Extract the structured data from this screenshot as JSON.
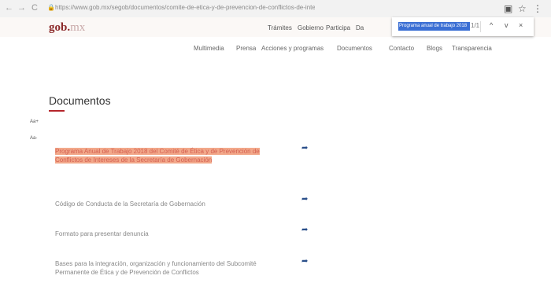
{
  "browser": {
    "back": "←",
    "forward": "→",
    "reload": "C",
    "lock": "🔒",
    "url": "https://www.gob.mx/segob/documentos/comite-de-etica-y-de-prevencion-de-conflictos-de-interes",
    "find": {
      "query": "Programa anual de trabajo 2018",
      "count": "1/1",
      "up": "^",
      "down": "v",
      "close": "×"
    }
  },
  "header": {
    "logo": "gob.",
    "logo_suffix": "mx",
    "nav": [
      "Trámites",
      "Gobierno",
      "Participa",
      "Da"
    ]
  },
  "subnav": [
    "Multimedia",
    "Prensa",
    "Acciones y programas",
    "Documentos",
    "Contacto",
    "Blogs",
    "Transparencia"
  ],
  "main": {
    "title": "Documentos",
    "font_increase": "Aa+",
    "font_decrease": "Aa-",
    "documents": [
      {
        "title": "Programa Anual de Trabajo 2018 del Comité de Ética y de Prevención de Conflictos de Intereses de la Secretaría de Gobernación",
        "highlighted": true
      },
      {
        "title": "Código de Conducta de la Secretaría de Gobernación",
        "highlighted": false
      },
      {
        "title": "Formato para presentar denuncia",
        "highlighted": false
      },
      {
        "title": "Bases para la integración, organización y funcionamiento del Subcomité Permanente de Ética y de Prevención de Conflictos",
        "highlighted": false
      }
    ]
  }
}
